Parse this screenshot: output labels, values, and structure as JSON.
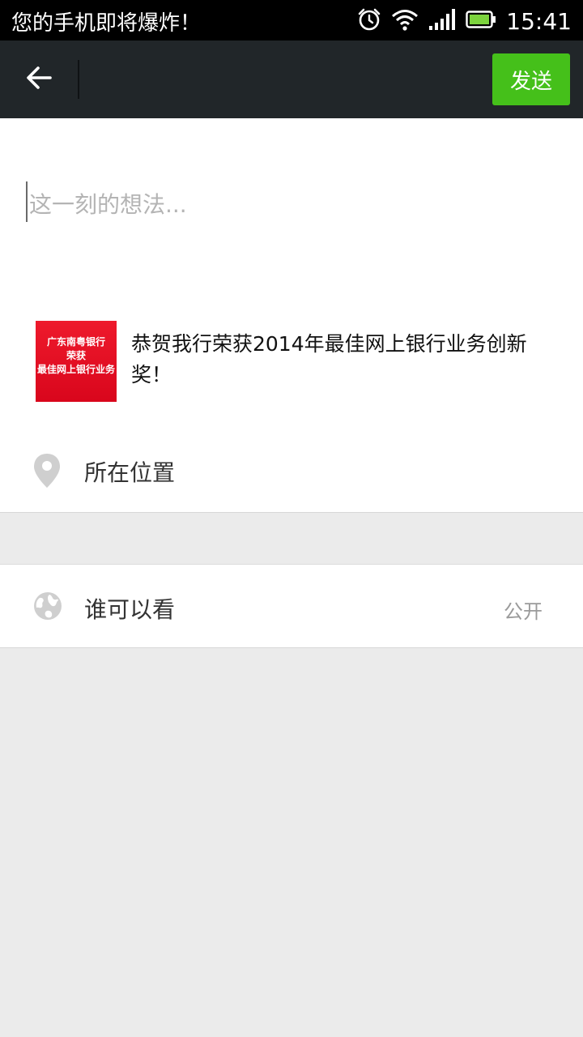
{
  "status_bar": {
    "notification": "您的手机即将爆炸！",
    "time": "15:41"
  },
  "app_bar": {
    "send_label": "发送"
  },
  "compose": {
    "placeholder": "这一刻的想法..."
  },
  "shared_card": {
    "thumb_lines": [
      "广东南粤银行",
      "荣获",
      "最佳网上银行业务"
    ],
    "title": "恭贺我行荣获2014年最佳网上银行业务创新奖！"
  },
  "location": {
    "label": "所在位置"
  },
  "visibility": {
    "label": "谁可以看",
    "value": "公开"
  },
  "icons": {
    "back": "arrow-back-icon",
    "alarm": "alarm-icon",
    "wifi": "wifi-icon",
    "signal": "signal-icon",
    "battery": "battery-icon",
    "location": "location-pin-icon",
    "globe": "globe-icon"
  },
  "colors": {
    "app_bar": "#212629",
    "send_button": "#45c01a",
    "page_background": "#ebebeb"
  }
}
